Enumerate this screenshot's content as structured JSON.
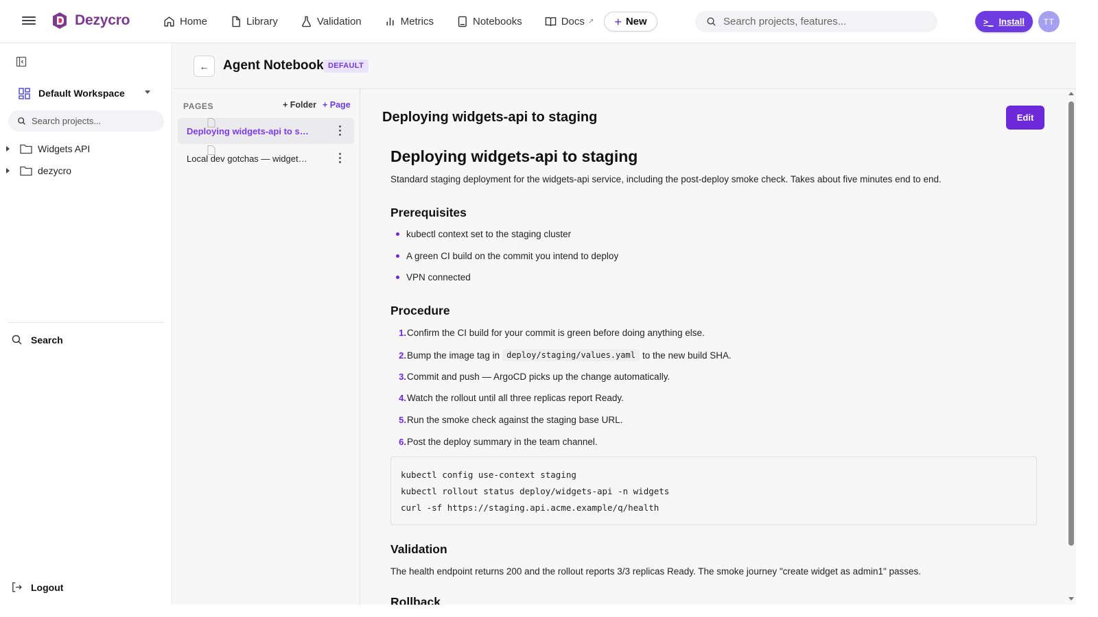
{
  "app": {
    "brand": "Dezycro",
    "avatar_initials": "TT",
    "accent": "#6d28d9"
  },
  "nav": {
    "items": [
      {
        "label": "Home",
        "icon": "home-icon"
      },
      {
        "label": "Library",
        "icon": "file-icon"
      },
      {
        "label": "Validation",
        "icon": "flask-icon"
      },
      {
        "label": "Metrics",
        "icon": "bar-chart-icon"
      },
      {
        "label": "Notebooks",
        "icon": "notebook-icon"
      },
      {
        "label": "Docs",
        "icon": "book-open-icon",
        "external_mark": "↗"
      }
    ],
    "new_label": "New",
    "search_placeholder": "Search projects, features...",
    "install_label": "Install",
    "install_prompt": ">_"
  },
  "sidebar": {
    "workspace": "Default Workspace",
    "search_placeholder": "Search projects...",
    "tree": [
      {
        "label": "Widgets API"
      },
      {
        "label": "dezycro"
      }
    ],
    "search_label": "Search",
    "logout_label": "Logout"
  },
  "notebook": {
    "back": "←",
    "title": "Agent Notebook",
    "badge": "DEFAULT",
    "pages_label": "PAGES",
    "add_folder": "+ Folder",
    "add_page": "+ Page",
    "pages": [
      {
        "title": "Deploying widgets-api to staging",
        "active": true
      },
      {
        "title": "Local dev gotchas — widgets-api",
        "active": false
      }
    ]
  },
  "doc": {
    "header_title": "Deploying widgets-api to staging",
    "edit_label": "Edit",
    "h1": "Deploying widgets-api to staging",
    "intro": "Standard staging deployment for the widgets-api service, including the post-deploy smoke check. Takes about five minutes end to end.",
    "prereq_heading": "Prerequisites",
    "prereqs": [
      "kubectl context set to the staging cluster",
      "A green CI build on the commit you intend to deploy",
      "VPN connected"
    ],
    "procedure_heading": "Procedure",
    "steps": [
      {
        "num": "1.",
        "text": "Confirm the CI build for your commit is green before doing anything else."
      },
      {
        "num": "2.",
        "before": "Bump the image tag in",
        "code": "deploy/staging/values.yaml",
        "after": "to the new build SHA."
      },
      {
        "num": "3.",
        "text": "Commit and push — ArgoCD picks up the change automatically."
      },
      {
        "num": "4.",
        "text": "Watch the rollout until all three replicas report Ready."
      },
      {
        "num": "5.",
        "text": "Run the smoke check against the staging base URL."
      },
      {
        "num": "6.",
        "text": "Post the deploy summary in the team channel."
      }
    ],
    "code_lines": [
      "kubectl config use-context staging",
      "kubectl rollout status deploy/widgets-api -n widgets",
      "curl -sf https://staging.api.acme.example/q/health"
    ],
    "validation_heading": "Validation",
    "validation_text": "The health endpoint returns 200 and the rollout reports 3/3 replicas Ready. The smoke journey \"create widget as admin1\" passes.",
    "rollback_heading": "Rollback"
  }
}
